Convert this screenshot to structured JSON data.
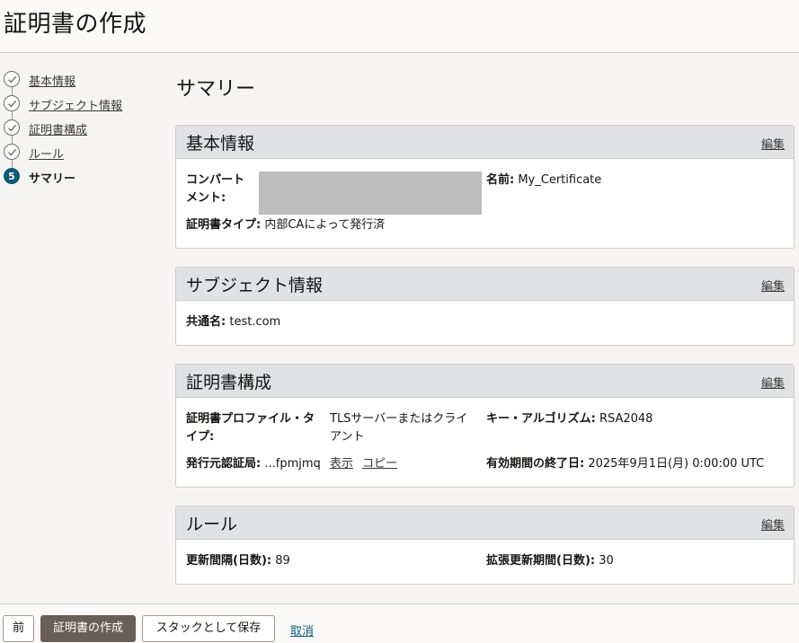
{
  "page_title": "証明書の作成",
  "steps": [
    {
      "label": "基本情報",
      "state": "done"
    },
    {
      "label": "サブジェクト情報",
      "state": "done"
    },
    {
      "label": "証明書構成",
      "state": "done"
    },
    {
      "label": "ルール",
      "state": "done"
    },
    {
      "label": "サマリー",
      "state": "current",
      "number": "5"
    }
  ],
  "summary_title": "サマリー",
  "edit_label": "編集",
  "basic": {
    "title": "基本情報",
    "compartment_label": "コンパート\nメント:",
    "name_label": "名前:",
    "name_value": "My_Certificate",
    "cert_type_label": "証明書タイプ:",
    "cert_type_value": "内部CAによって発行済"
  },
  "subject": {
    "title": "サブジェクト情報",
    "common_name_label": "共通名:",
    "common_name_value": "test.com"
  },
  "config": {
    "title": "証明書構成",
    "profile_label": "証明書プロファイル・タ\nイプ:",
    "profile_value": "TLSサーバーまたはクライ\nアント",
    "key_algo_label": "キー・アルゴリズム:",
    "key_algo_value": "RSA2048",
    "issuer_label": "発行元認証局:",
    "issuer_value": "...fpmjmq",
    "show_link": "表示",
    "copy_link": "コピー",
    "expiry_label": "有効期間の終了日:",
    "expiry_value": "2025年9月1日(月) 0:00:00 UTC"
  },
  "rules": {
    "title": "ルール",
    "renewal_label": "更新間隔(日数):",
    "renewal_value": "89",
    "extended_label": "拡張更新期間(日数):",
    "extended_value": "30"
  },
  "footer": {
    "prev_label": "前",
    "create_label": "証明書の作成",
    "save_stack_label": "スタックとして保存",
    "cancel_label": "取消"
  }
}
